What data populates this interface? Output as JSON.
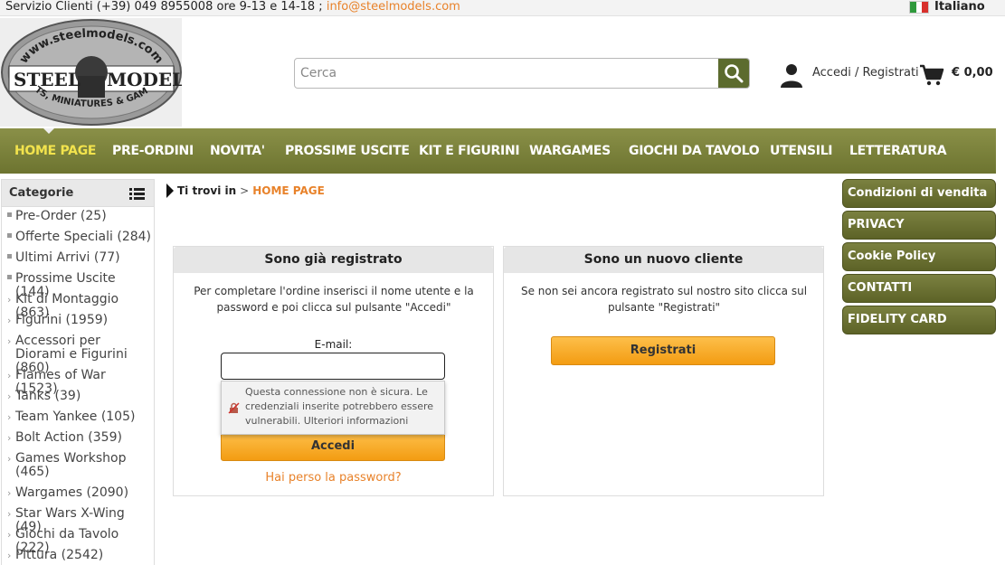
{
  "topbar": {
    "contact_text": "Servizio Clienti (+39) 049 8955008 ore 9-13 e 14-18 ;",
    "email": "info@steelmodels.com",
    "language": "Italiano"
  },
  "logo": {
    "arc_text": "www.steelmodels.com",
    "brand_left": "STEEL",
    "brand_right": "MODELS",
    "tagline": "KITS, MINIATURES & GAMES"
  },
  "search": {
    "placeholder": "Cerca"
  },
  "account": {
    "login_label": "Accedi / Registrati"
  },
  "cart": {
    "total": "€ 0,00"
  },
  "nav": {
    "items": [
      {
        "label": "HOME PAGE"
      },
      {
        "label": "PRE-ORDINI"
      },
      {
        "label": "NOVITA'"
      },
      {
        "label": "PROSSIME USCITE"
      },
      {
        "label": "KIT E FIGURINI"
      },
      {
        "label": "WARGAMES"
      },
      {
        "label": "GIOCHI DA TAVOLO"
      },
      {
        "label": "UTENSILI"
      },
      {
        "label": "LETTERATURA"
      }
    ]
  },
  "sidebar": {
    "title": "Categorie",
    "items": [
      {
        "label": "Pre-Order (25)",
        "bullet": "square"
      },
      {
        "label": "Offerte Speciali (284)",
        "bullet": "square"
      },
      {
        "label": "Ultimi Arrivi (77)",
        "bullet": "square"
      },
      {
        "label": "Prossime Uscite (144)",
        "bullet": "square"
      },
      {
        "label": "Kit di Montaggio (863)",
        "bullet": "chevron"
      },
      {
        "label": "Figurini (1959)",
        "bullet": "chevron"
      },
      {
        "label": "Accessori per Diorami e Figurini (860)",
        "bullet": "chevron"
      },
      {
        "label": "Flames of War (1523)",
        "bullet": "chevron"
      },
      {
        "label": "Tanks (39)",
        "bullet": "chevron"
      },
      {
        "label": "Team Yankee (105)",
        "bullet": "chevron"
      },
      {
        "label": "Bolt Action (359)",
        "bullet": "chevron"
      },
      {
        "label": "Games Workshop (465)",
        "bullet": "chevron"
      },
      {
        "label": "Wargames (2090)",
        "bullet": "chevron"
      },
      {
        "label": "Star Wars X-Wing (49)",
        "bullet": "chevron"
      },
      {
        "label": "Giochi da Tavolo (222)",
        "bullet": "chevron"
      },
      {
        "label": "Pittura (2542)",
        "bullet": "chevron"
      }
    ]
  },
  "breadcrumb": {
    "label": "Ti trovi in",
    "separator": ">",
    "current": "HOME PAGE"
  },
  "login_panel": {
    "title": "Sono già registrato",
    "text": "Per completare l'ordine inserisci il nome utente e la password e poi clicca sul pulsante \"Accedi\"",
    "email_label": "E-mail:",
    "email_value": "",
    "submit_label": "Accedi",
    "forgot_label": "Hai perso la password?"
  },
  "insecure_warning": {
    "message": "Questa connessione non è sicura. Le credenziali inserite potrebbero essere vulnerabili.",
    "more_link": "Ulteriori informazioni"
  },
  "register_panel": {
    "title": "Sono un nuovo cliente",
    "text": "Se non sei ancora registrato sul nostro sito clicca sul pulsante \"Registrati\"",
    "button_label": "Registrati"
  },
  "right_menu": {
    "items": [
      {
        "label": "Condizioni di vendita"
      },
      {
        "label": "PRIVACY"
      },
      {
        "label": "Cookie Policy"
      },
      {
        "label": "CONTATTI"
      },
      {
        "label": "FIDELITY CARD"
      }
    ]
  },
  "colors": {
    "brand_olive": "#6d7430",
    "accent_orange": "#e8822a",
    "nav_active": "#f2e34d"
  }
}
